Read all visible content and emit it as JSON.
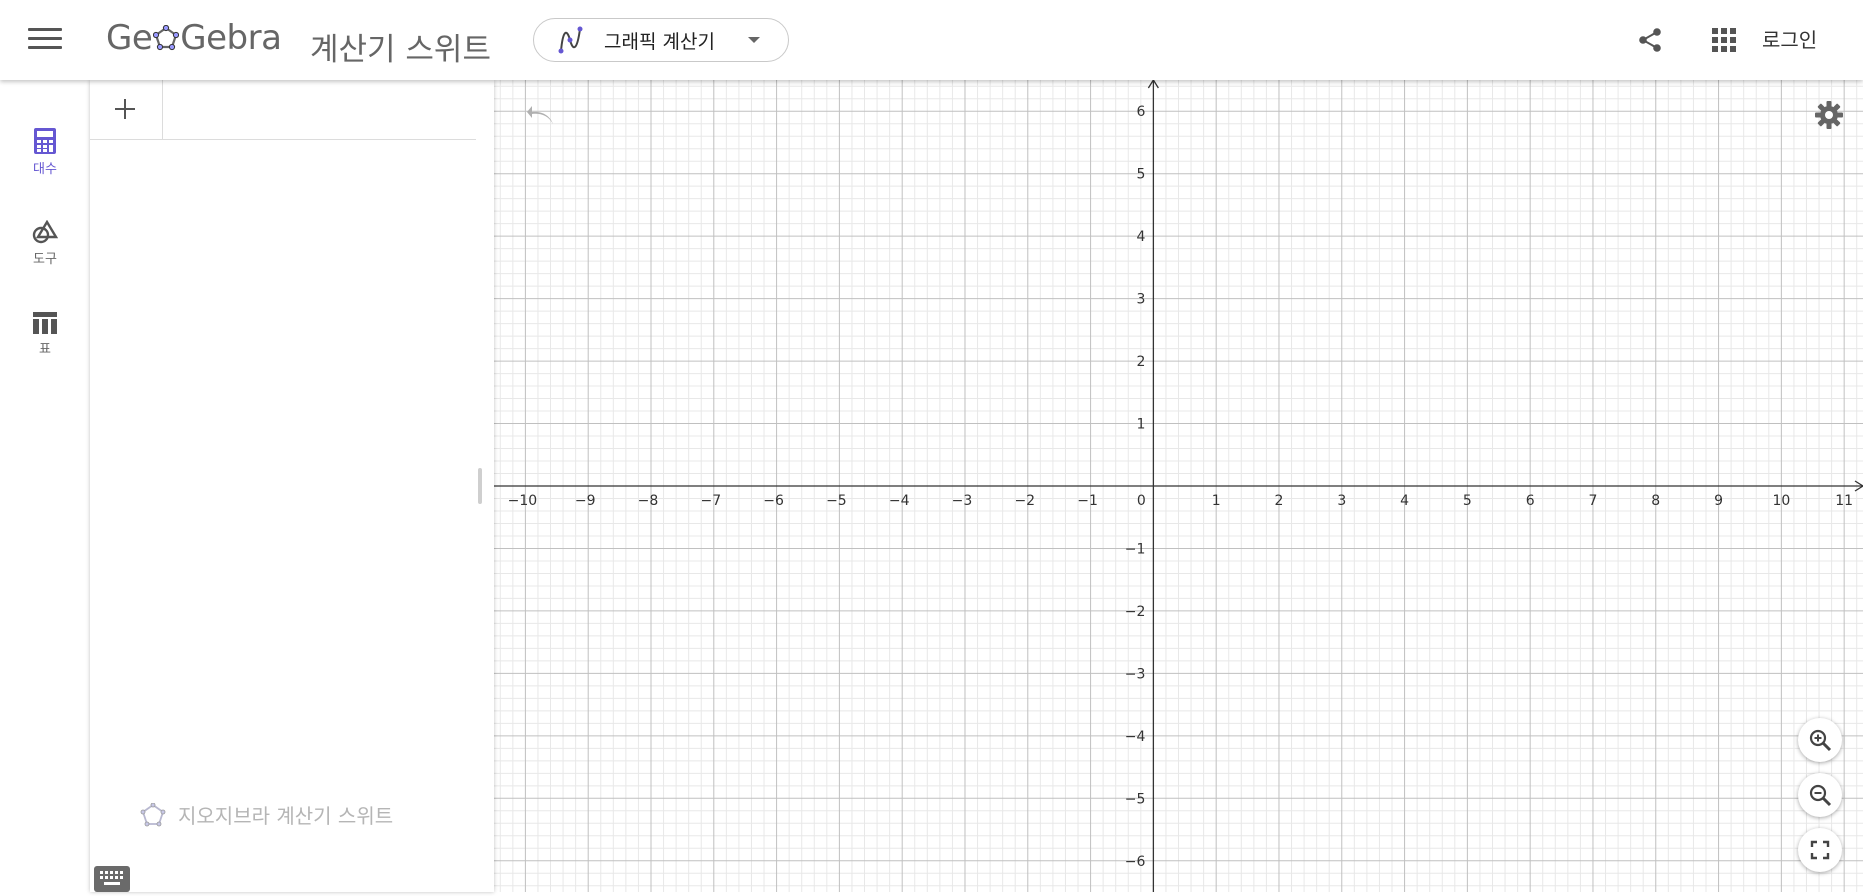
{
  "header": {
    "logo_left": "Ge",
    "logo_right": "Gebra",
    "suite_title": "계산기 스위트",
    "app_selector_label": "그래픽 계산기",
    "login_label": "로그인"
  },
  "sidebar": {
    "items": [
      {
        "label": "대수",
        "icon": "calculator-icon",
        "active": true
      },
      {
        "label": "도구",
        "icon": "shapes-icon",
        "active": false
      },
      {
        "label": "표",
        "icon": "table-icon",
        "active": false
      }
    ]
  },
  "algebra": {
    "input_value": "",
    "branding": "지오지브라 계산기 스위트"
  },
  "graph": {
    "x_ticks": [
      "−10",
      "−9",
      "−8",
      "−7",
      "−6",
      "−5",
      "−4",
      "−3",
      "−2",
      "−1",
      "0",
      "1",
      "2",
      "3",
      "4",
      "5",
      "6",
      "7",
      "8",
      "9",
      "10",
      "11"
    ],
    "y_ticks": [
      "6",
      "5",
      "4",
      "3",
      "2",
      "1",
      "−1",
      "−2",
      "−3",
      "−4",
      "−5",
      "−6"
    ],
    "x_range": [
      -10.5,
      11.3
    ],
    "y_range": [
      -6.5,
      6.5
    ]
  },
  "colors": {
    "accent": "#6557d2",
    "grid_major": "#c0c0c0",
    "grid_minor": "#e8e8e8",
    "axis": "#333333"
  }
}
